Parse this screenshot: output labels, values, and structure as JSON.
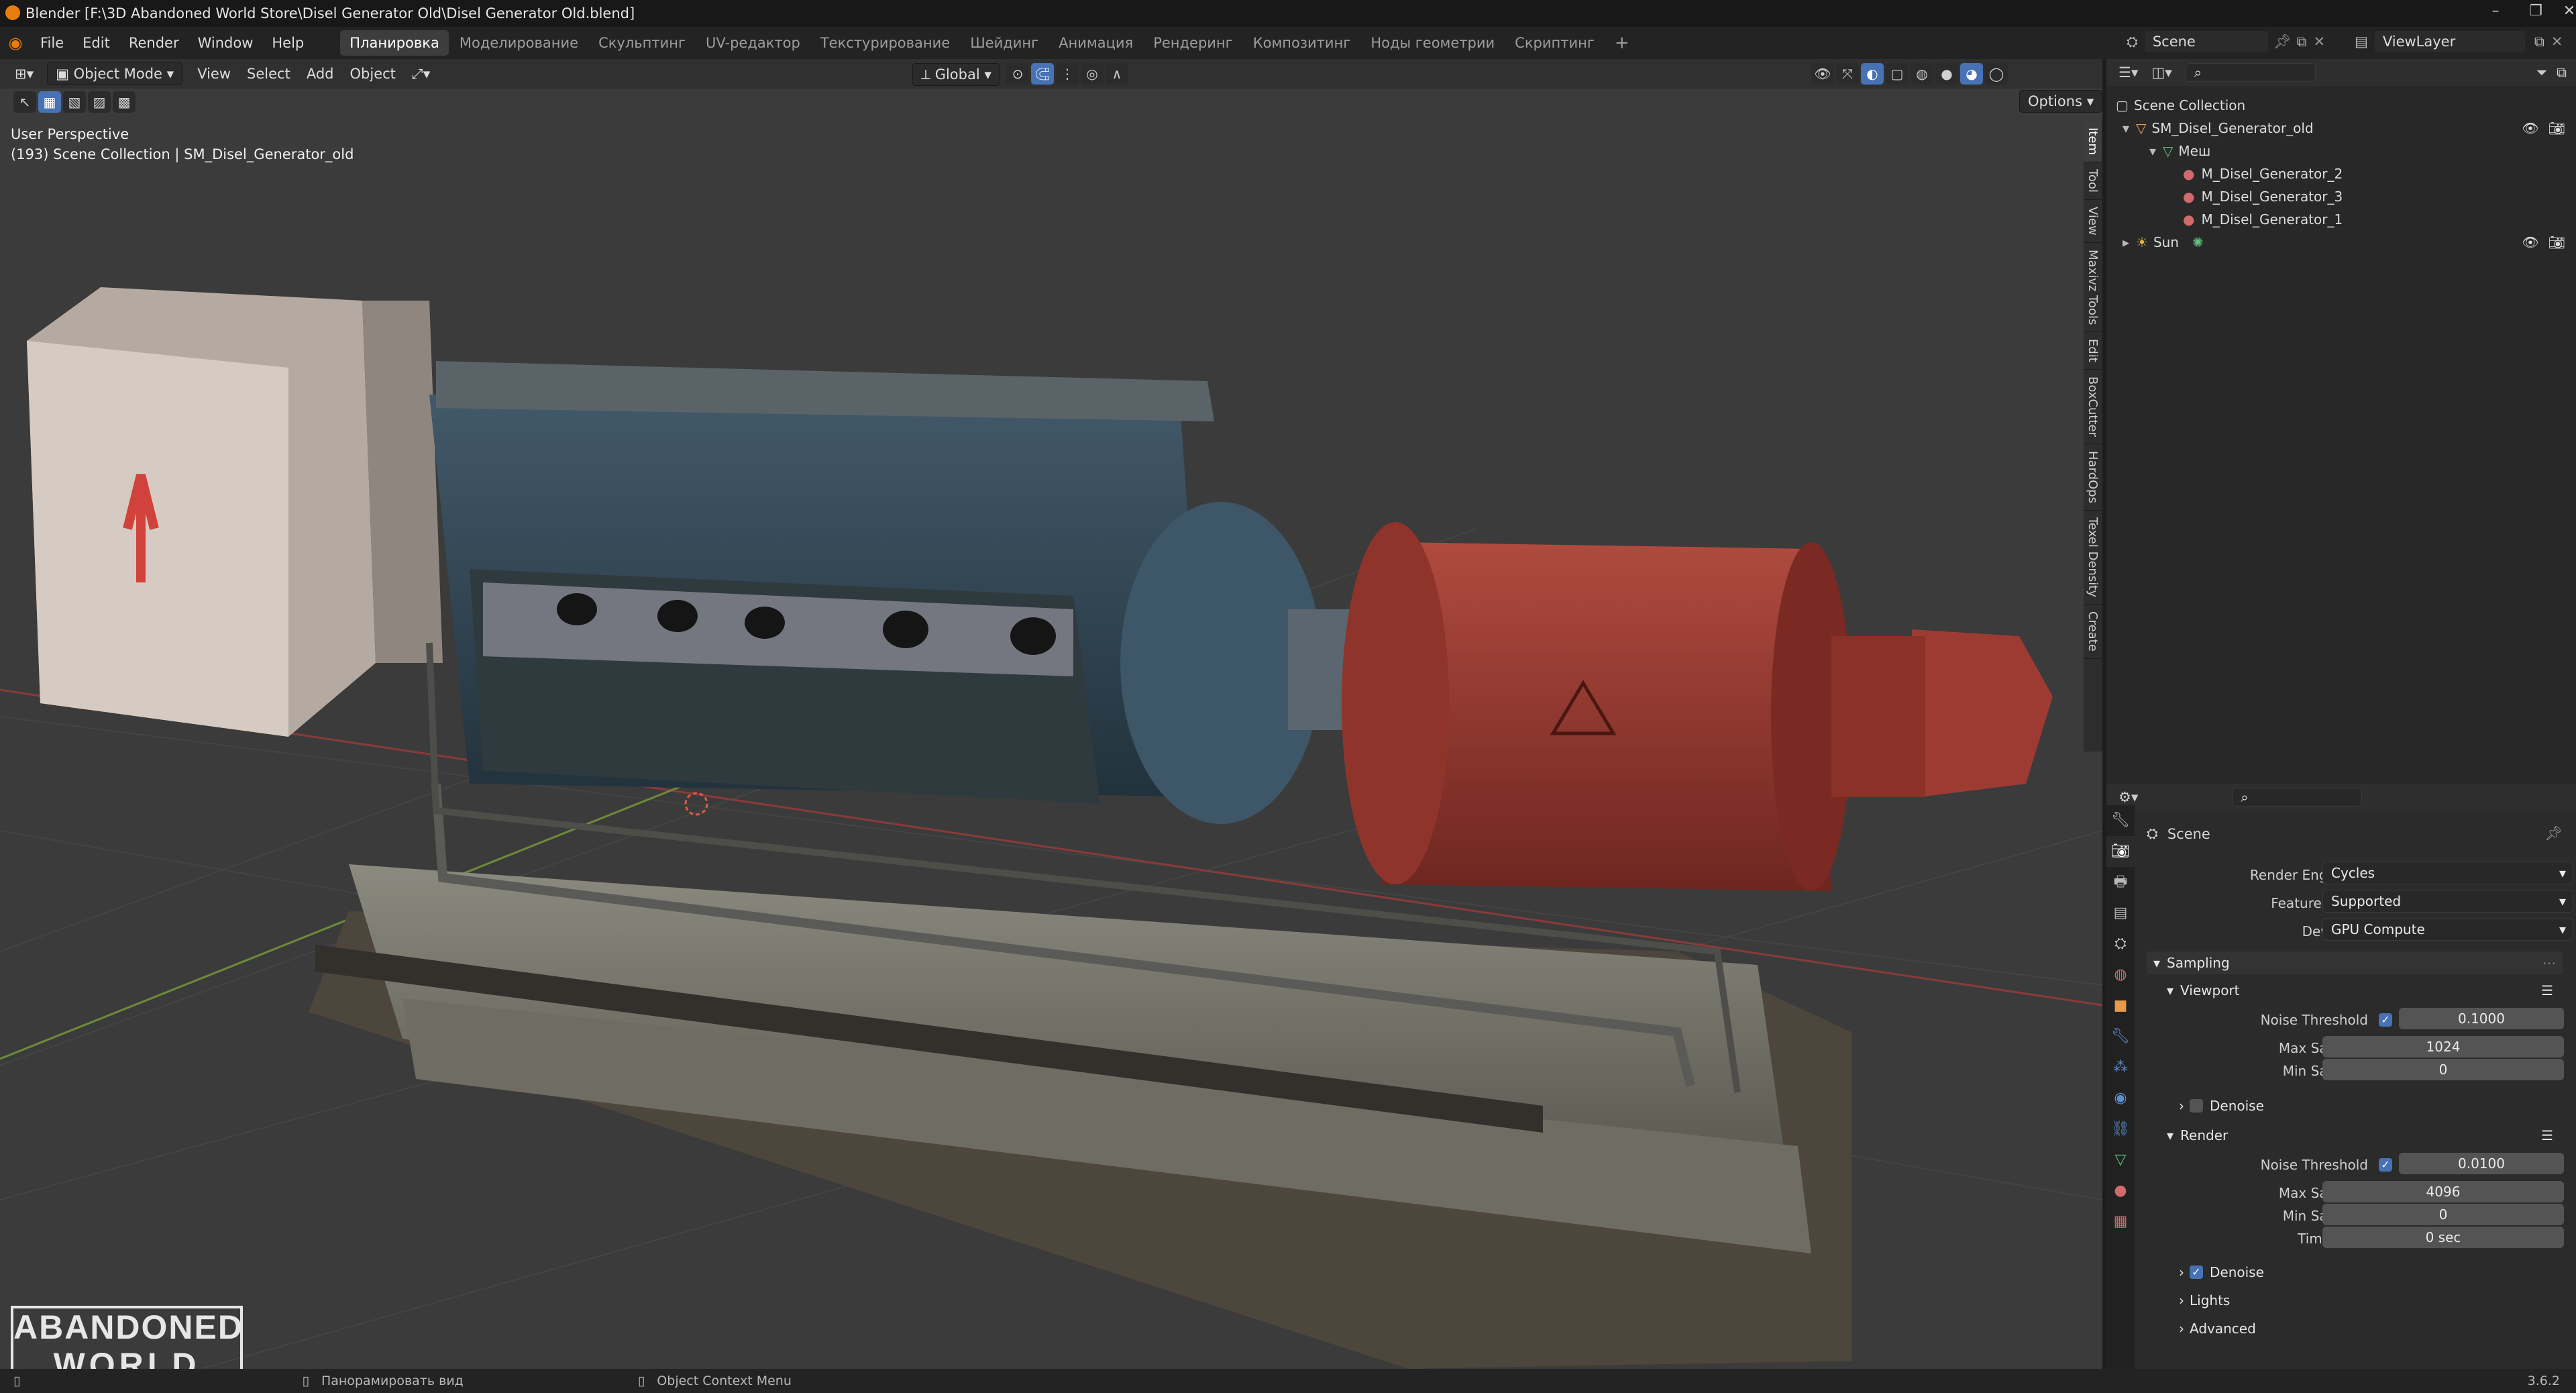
{
  "window": {
    "title": "Blender [F:\\3D Abandoned World Store\\Disel Generator Old\\Disel Generator Old.blend]"
  },
  "menu": [
    "File",
    "Edit",
    "Render",
    "Window",
    "Help"
  ],
  "workspaces": [
    "Планировка",
    "Моделирование",
    "Скульптинг",
    "UV-редактор",
    "Текстурирование",
    "Шейдинг",
    "Анимация",
    "Рендеринг",
    "Композитинг",
    "Ноды геометрии",
    "Скриптинг"
  ],
  "topright": {
    "scene": "Scene",
    "view_layer": "ViewLayer"
  },
  "viewport": {
    "mode": "Object Mode",
    "menus": [
      "View",
      "Select",
      "Add",
      "Object"
    ],
    "transform": "Global",
    "options": "Options",
    "info_line1": "User Perspective",
    "info_line2": "(193) Scene Collection | SM_Disel_Generator_old",
    "side_tabs": [
      "Item",
      "Tool",
      "View",
      "Maxivz Tools",
      "Edit",
      "BoxCutter",
      "HardOps",
      "Texel Density",
      "Create"
    ]
  },
  "outliner": {
    "root": "Scene Collection",
    "items": [
      {
        "label": "SM_Disel_Generator_old",
        "level": 1,
        "icon": "object-icon"
      },
      {
        "label": "Меш",
        "level": 2,
        "icon": "mesh-icon"
      },
      {
        "label": "M_Disel_Generator_2",
        "level": 3,
        "icon": "material-icon"
      },
      {
        "label": "M_Disel_Generator_3",
        "level": 3,
        "icon": "material-icon"
      },
      {
        "label": "M_Disel_Generator_1",
        "level": 3,
        "icon": "material-icon"
      },
      {
        "label": "Sun",
        "level": 1,
        "icon": "light-icon"
      }
    ]
  },
  "properties": {
    "context": "Scene",
    "render_engine_label": "Render Engine",
    "render_engine": "Cycles",
    "feature_set_label": "Feature Set",
    "feature_set": "Supported",
    "device_label": "Device",
    "device": "GPU Compute",
    "sampling": "Sampling",
    "viewport": {
      "title": "Viewport",
      "noise_label": "Noise Threshold",
      "noise": "0.1000",
      "max_label": "Max Samples",
      "max": "1024",
      "min_label": "Min Samples",
      "min": "0",
      "denoise": "Denoise"
    },
    "render": {
      "title": "Render",
      "noise_label": "Noise Threshold",
      "noise": "0.0100",
      "max_label": "Max Samples",
      "max": "4096",
      "min_label": "Min Samples",
      "min": "0",
      "time_label": "Time Limit",
      "time": "0 sec",
      "denoise": "Denoise"
    },
    "lights": "Lights",
    "advanced": "Advanced"
  },
  "status": {
    "item1": "Панорамировать вид",
    "item2": "Object Context Menu",
    "version": "3.6.2"
  },
  "logo": {
    "line1": "ABANDONED",
    "line2": "WORLD"
  },
  "colors": {
    "accent": "#4772b3",
    "selection": "#334d80",
    "viewport_bg": "#3b3b3b"
  }
}
